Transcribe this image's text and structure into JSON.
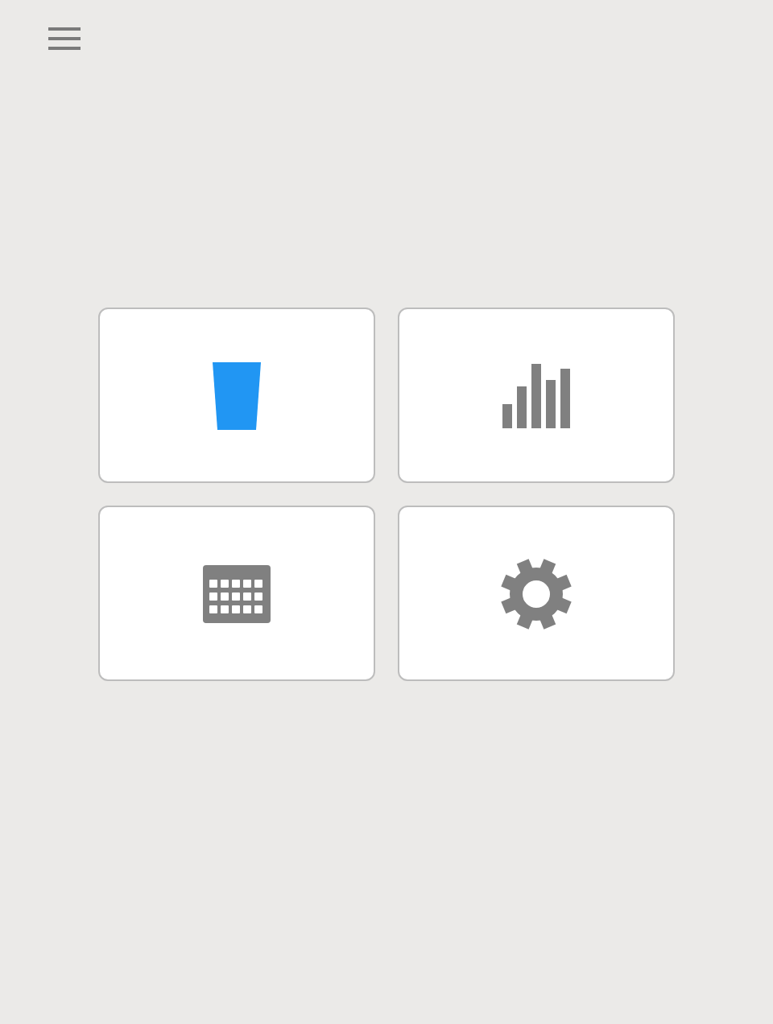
{
  "tiles": [
    {
      "kind": "cup",
      "color": "#2196f3"
    },
    {
      "kind": "chart",
      "color": "#808080"
    },
    {
      "kind": "calendar",
      "color": "#808080"
    },
    {
      "kind": "gear",
      "color": "#808080"
    }
  ]
}
